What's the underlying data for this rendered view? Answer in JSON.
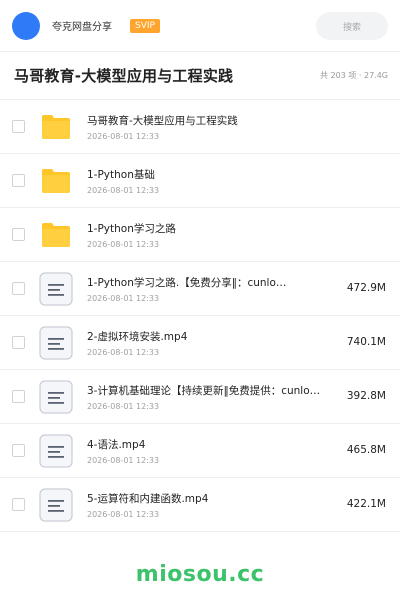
{
  "header": {
    "user_name": "夸克网盘分享",
    "badge": "SVIP",
    "search_placeholder": "搜索"
  },
  "folder": {
    "title": "马哥教育-大模型应用与工程实践",
    "meta": "共 203 项 · 27.4G"
  },
  "files": [
    {
      "type": "folder",
      "icon": "folder-icon",
      "name": "马哥教育-大模型应用与工程实践",
      "date": "2026-08-01 12:33",
      "size": ""
    },
    {
      "type": "folder",
      "icon": "folder-icon",
      "name": "1-Python基础",
      "date": "2026-08-01 12:33",
      "size": ""
    },
    {
      "type": "folder",
      "icon": "folder-icon",
      "name": "1-Python学习之路",
      "date": "2026-08-01 12:33",
      "size": ""
    },
    {
      "type": "file",
      "icon": "document-icon",
      "name": "1-Python学习之路.【免费分享‖：cunlo…",
      "date": "2026-08-01 12:33",
      "size": "472.9M"
    },
    {
      "type": "file",
      "icon": "document-icon",
      "name": "2-虚拟环境安装.mp4",
      "date": "2026-08-01 12:33",
      "size": "740.1M"
    },
    {
      "type": "file",
      "icon": "document-icon",
      "name": "3-计算机基础理论【持续更新‖免费提供：cunlo…",
      "date": "2026-08-01 12:33",
      "size": "392.8M"
    },
    {
      "type": "file",
      "icon": "document-icon",
      "name": "4-语法.mp4",
      "date": "2026-08-01 12:33",
      "size": "465.8M"
    },
    {
      "type": "file",
      "icon": "document-icon",
      "name": "5-运算符和内建函数.mp4",
      "date": "2026-08-01 12:33",
      "size": "422.1M"
    }
  ],
  "watermark": "miosou.cc",
  "colors": {
    "avatar": "#2f7bf7",
    "badge": "#ffa52e",
    "folder": "#ffc629",
    "watermark": "#3cc26a"
  }
}
